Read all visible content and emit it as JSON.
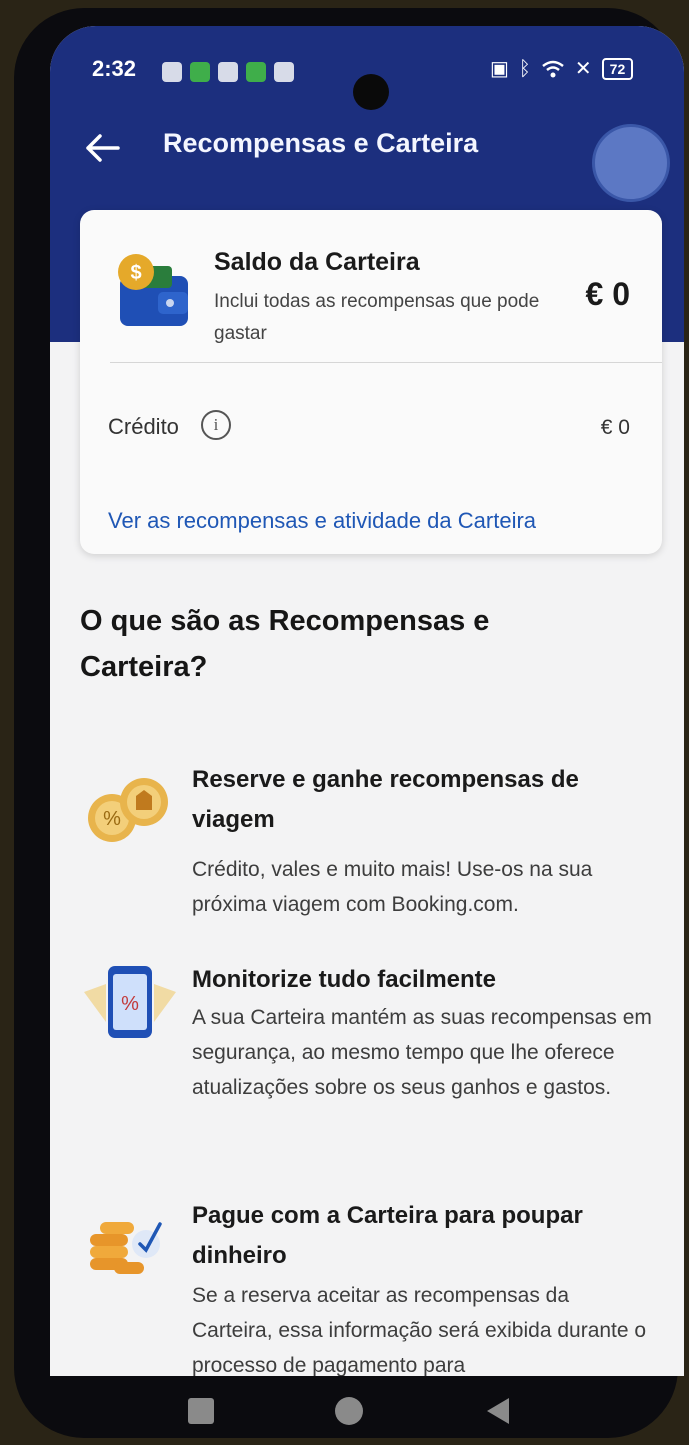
{
  "status_bar": {
    "time": "2:32",
    "battery": "72"
  },
  "app_bar": {
    "title": "Recompensas e Carteira"
  },
  "wallet_card": {
    "title": "Saldo da Carteira",
    "description": "Inclui todas as recompensas que pode gastar",
    "amount": "€ 0",
    "credit_label": "Crédito",
    "credit_amount": "€ 0",
    "link": "Ver as recompensas e atividade da Carteira"
  },
  "info": {
    "title": "O que são as Recompensas e Carteira?",
    "features": [
      {
        "icon": "coins-percent-icon",
        "title": "Reserve e ganhe recompensas de viagem",
        "description": "Crédito, vales e muito mais! Use-os na sua próxima viagem com Booking.com."
      },
      {
        "icon": "phone-percent-icon",
        "title": "Monitorize tudo facilmente",
        "description": "A sua Carteira mantém as suas recompensas em segurança, ao mesmo tempo que lhe oferece atualizações sobre os seus ganhos e gastos."
      },
      {
        "icon": "coins-check-icon",
        "title": "Pague com a Carteira para poupar dinheiro",
        "description": "Se a reserva aceitar as recompensas da Carteira, essa informação será exibida durante o processo de pagamento para"
      }
    ]
  },
  "colors": {
    "app_bar": "#1c2f7e",
    "link": "#1f57b5",
    "background": "#f3f3f4"
  }
}
